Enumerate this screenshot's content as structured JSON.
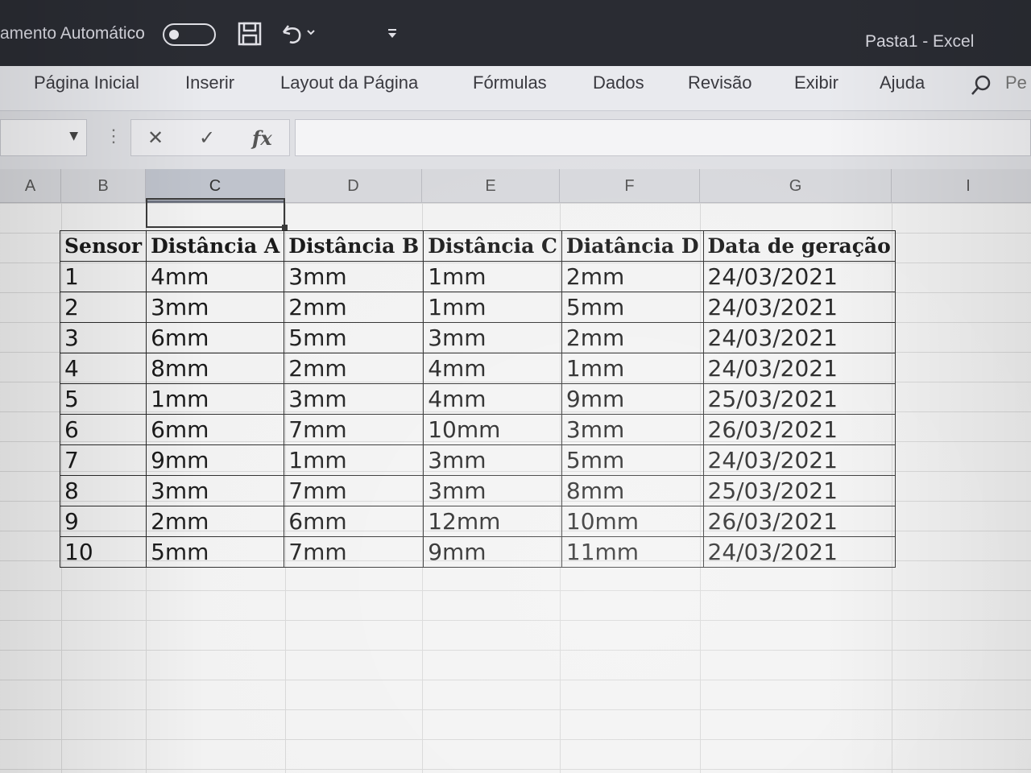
{
  "titlebar": {
    "autosave_label": "amento Automático",
    "save_icon": "save-icon",
    "undo_icon": "undo-icon",
    "customize_icon": "customize-qat-icon",
    "doc_title": "Pasta1  -  Excel"
  },
  "ribbon": {
    "tabs": [
      "Página Inicial",
      "Inserir",
      "Layout da Página",
      "Fórmulas",
      "Dados",
      "Revisão",
      "Exibir",
      "Ajuda"
    ],
    "search_partial": "Pe"
  },
  "formula_bar": {
    "cancel_symbol": "✕",
    "enter_symbol": "✓",
    "fx_symbol": "fx",
    "value": ""
  },
  "sheet": {
    "columns": [
      "A",
      "B",
      "C",
      "D",
      "E",
      "F",
      "G",
      "I"
    ],
    "selected_column": "C",
    "table": {
      "headers": [
        "Sensor",
        "Distância A",
        "Distância B",
        "Distância C",
        "Diatância D",
        "Data de geração"
      ],
      "rows": [
        [
          "1",
          "4mm",
          "3mm",
          "1mm",
          "2mm",
          "24/03/2021"
        ],
        [
          "2",
          "3mm",
          "2mm",
          "1mm",
          "5mm",
          "24/03/2021"
        ],
        [
          "3",
          "6mm",
          "5mm",
          "3mm",
          "2mm",
          "24/03/2021"
        ],
        [
          "4",
          "8mm",
          "2mm",
          "4mm",
          "1mm",
          "24/03/2021"
        ],
        [
          "5",
          "1mm",
          "3mm",
          "4mm",
          "9mm",
          "25/03/2021"
        ],
        [
          "6",
          "6mm",
          "7mm",
          "10mm",
          "3mm",
          "26/03/2021"
        ],
        [
          "7",
          "9mm",
          "1mm",
          "3mm",
          "5mm",
          "24/03/2021"
        ],
        [
          "8",
          "3mm",
          "7mm",
          "3mm",
          "8mm",
          "25/03/2021"
        ],
        [
          "9",
          "2mm",
          "6mm",
          "12mm",
          "10mm",
          "26/03/2021"
        ],
        [
          "10",
          "5mm",
          "7mm",
          "9mm",
          "11mm",
          "24/03/2021"
        ]
      ]
    }
  }
}
